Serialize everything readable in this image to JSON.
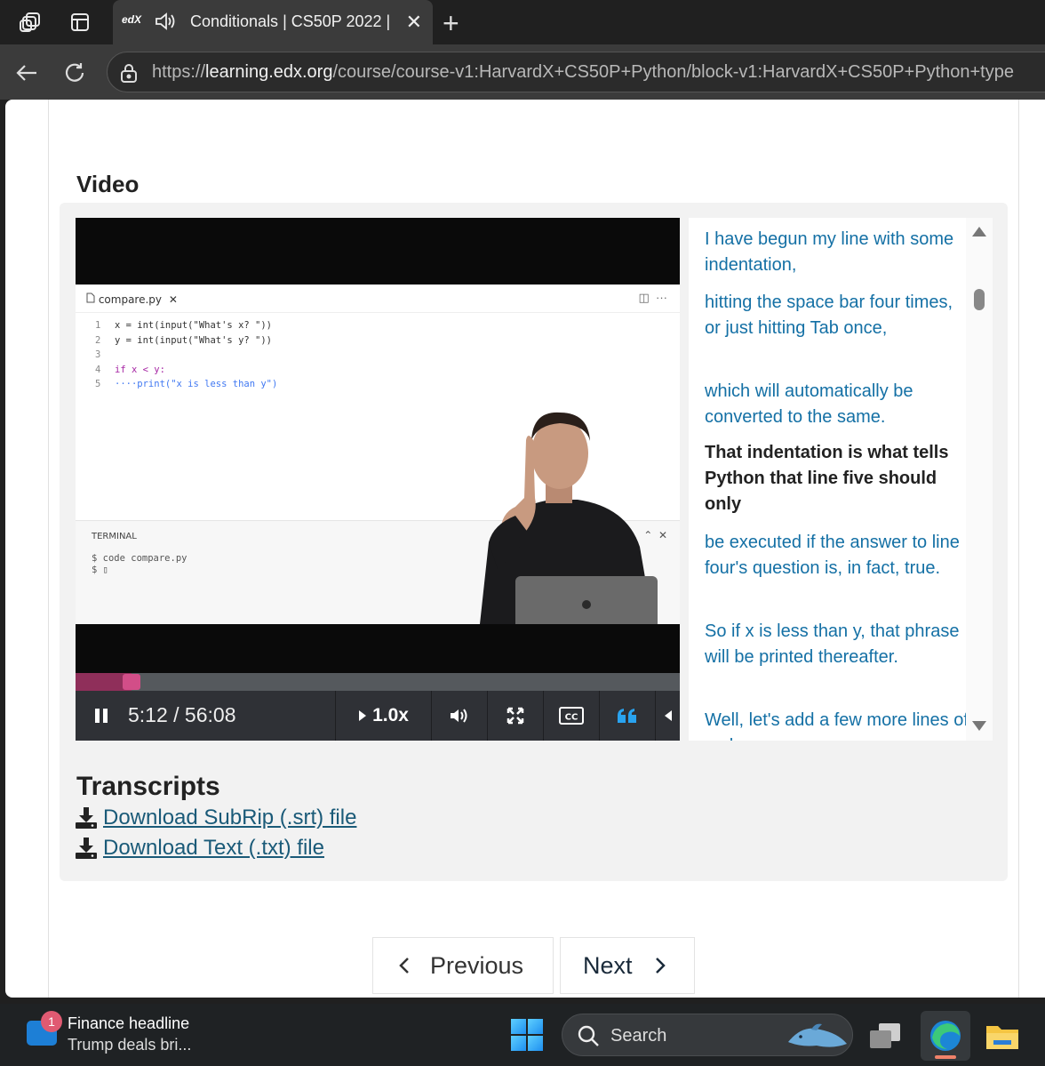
{
  "browser": {
    "tab_favicon": "edX",
    "tab_title": "Conditionals | CS50P 2022 | (",
    "url_scheme": "https://",
    "url_host": "learning.edx.org",
    "url_path": "/course/course-v1:HarvardX+CS50P+Python/block-v1:HarvardX+CS50P+Python+type"
  },
  "video": {
    "heading": "Video",
    "editor_file": "compare.py",
    "code_lines": [
      {
        "n": "1",
        "text": "x = int(input(\"What's x? \"))"
      },
      {
        "n": "2",
        "text": "y = int(input(\"What's y? \"))"
      },
      {
        "n": "3",
        "text": ""
      },
      {
        "n": "4",
        "text": "if x < y:"
      },
      {
        "n": "5",
        "text": "····print(\"x is less than y\")"
      }
    ],
    "terminal_title": "TERMINAL",
    "terminal_line1": "$ code compare.py",
    "terminal_line2": "$ ▯",
    "time": "5:12 / 56:08",
    "speed": "1.0x",
    "progress_fraction": 0.0925
  },
  "transcript": {
    "cues": [
      {
        "text": "I have begun my line with some indentation,",
        "active": false
      },
      {
        "text": "hitting the space bar four times, or just hitting Tab once,",
        "active": false
      },
      {
        "text": "which will automatically be converted to the same.",
        "active": false
      },
      {
        "text": "That indentation is what tells Python that line five should only",
        "active": true
      },
      {
        "text": "be executed if the answer to line four's question is, in fact, true.",
        "active": false
      },
      {
        "text": "So if x is less than y, that phrase will be printed thereafter.",
        "active": false
      },
      {
        "text": "Well, let's add a few more lines of code",
        "active": false
      }
    ]
  },
  "transcripts": {
    "heading": "Transcripts",
    "srt_link": "Download SubRip (.srt) file",
    "txt_link": "Download Text (.txt) file"
  },
  "pager": {
    "previous": "Previous",
    "next": "Next"
  },
  "taskbar": {
    "news_badge": "1",
    "news_title": "Finance headline",
    "news_sub": "Trump deals bri...",
    "search_label": "Search"
  },
  "colors": {
    "accent_link": "#1470a5",
    "progress": "#d24e88",
    "cc_blue": "#29a3ef"
  }
}
